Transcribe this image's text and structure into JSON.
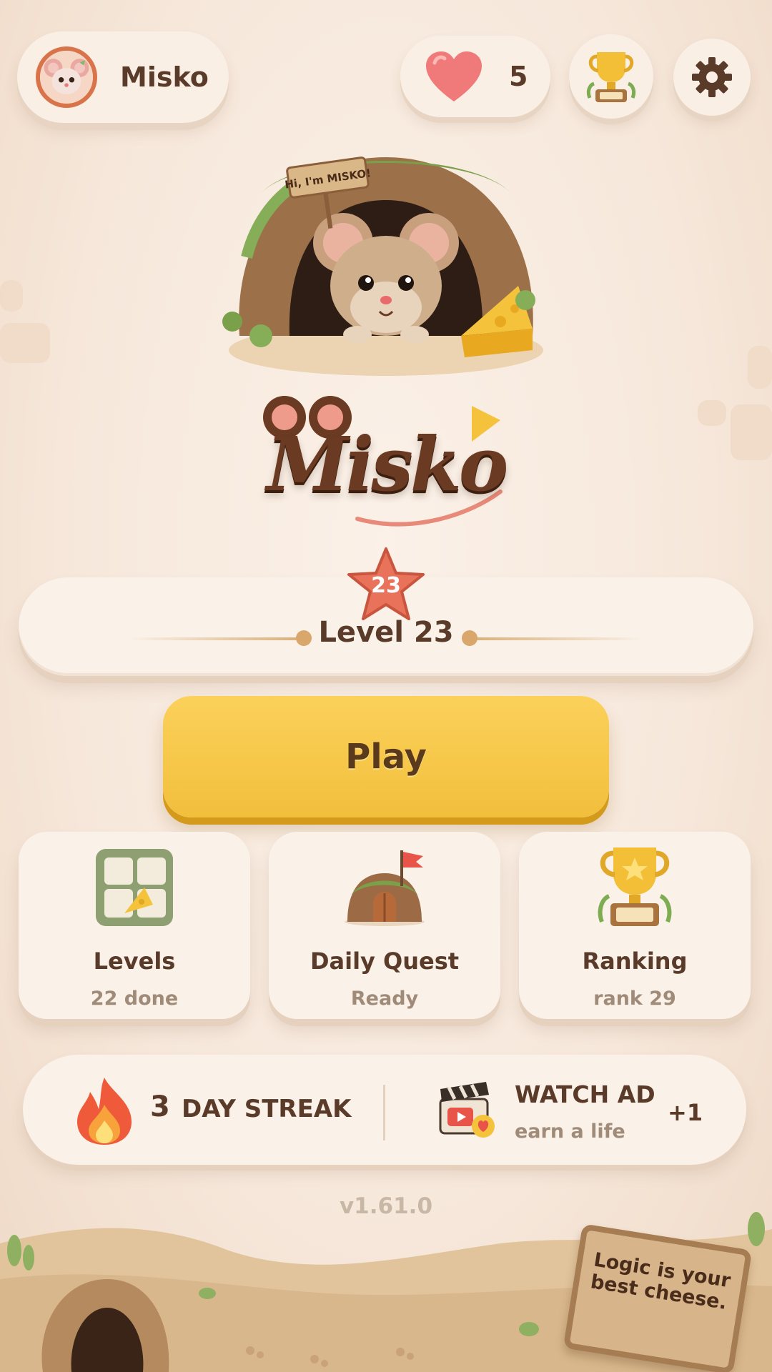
{
  "player": {
    "name": "Misko",
    "avatar_icon": "mouse-avatar-icon"
  },
  "lives": {
    "count": "5",
    "icon": "heart-icon"
  },
  "hero": {
    "sign_text": "Hi, I'm MISKO!"
  },
  "logo": {
    "text": "Misko"
  },
  "level": {
    "badge_number": "23",
    "label": "Level 23"
  },
  "play": {
    "label": "Play"
  },
  "cards": [
    {
      "title": "Levels",
      "subtitle": "22 done",
      "icon": "levels-grid-icon"
    },
    {
      "title": "Daily Quest",
      "subtitle": "Ready",
      "icon": "mouse-house-icon"
    },
    {
      "title": "Ranking",
      "subtitle": "rank 29",
      "icon": "trophy-icon"
    }
  ],
  "streak": {
    "count": "3",
    "label": "DAY STREAK",
    "icon": "fire-icon"
  },
  "ad": {
    "title": "WATCH AD",
    "subtitle": "earn a life",
    "reward": "+1",
    "icon": "clapperboard-icon"
  },
  "version": "v1.61.0",
  "footer_sign": {
    "text": "Logic is your best cheese."
  },
  "colors": {
    "background": "#f7ebe0",
    "play_button": "#f5c443",
    "text_primary": "#5a3a28",
    "text_secondary": "#a08a78",
    "star_badge": "#e8735a",
    "heart": "#f07a7a"
  }
}
